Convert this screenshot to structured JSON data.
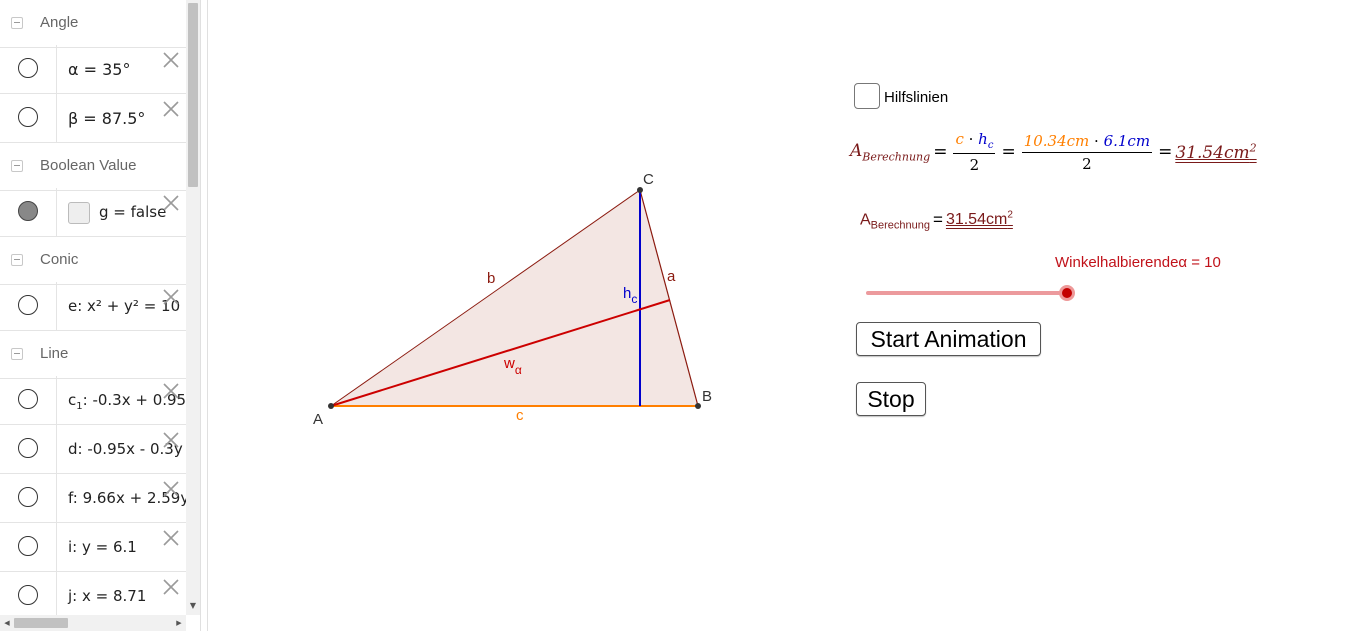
{
  "algebra": {
    "groups": {
      "angle": "Angle",
      "boolean": "Boolean Value",
      "conic": "Conic",
      "line": "Line"
    },
    "items": {
      "alpha": "α = 35°",
      "beta": "β = 87.5°",
      "g": "g = false",
      "e": "e: x² + y² = 10",
      "c1_name": "c",
      "c1_sub": "1",
      "c1_rest": ": -0.3x + 0.95",
      "d": "d: -0.95x - 0.3y",
      "f": "f: 9.66x + 2.59y",
      "i": "i: y = 6.1",
      "j": "j: x = 8.71"
    }
  },
  "graphics": {
    "points": {
      "A": "A",
      "B": "B",
      "C": "C"
    },
    "segments": {
      "a": "a",
      "b": "b",
      "c": "c"
    },
    "altitude": {
      "name": "h",
      "sub": "c"
    },
    "bisector": {
      "name": "w",
      "sub": "α"
    },
    "colors": {
      "triangle_fill": "#f3e6e3",
      "triangle_stroke": "#8b1a0f",
      "side_c": "#ff7f00",
      "altitude": "#0000cc",
      "bisector": "#cc0000"
    }
  },
  "controls": {
    "checkbox_label": "Hilfslinien",
    "formula1": {
      "lhs_main": "A",
      "lhs_sub": "Berechnung",
      "frac1_num_c": "c",
      "frac1_num_dot": " · ",
      "frac1_num_h": "h",
      "frac1_num_hsub": "c",
      "frac1_den": "2",
      "frac2_num_left": "10.34cm",
      "frac2_num_dot": " · ",
      "frac2_num_right": "6.1cm",
      "frac2_den": "2",
      "result": "31.54cm",
      "result_exp": "2"
    },
    "formula2": {
      "lhs_main": "A",
      "lhs_sub": "Berechnung",
      "result": "31.54cm",
      "result_exp": "2"
    },
    "slider": {
      "caption": "Winkelhalbierendeα = 10",
      "value": 10
    },
    "start_button": "Start Animation",
    "stop_button": "Stop"
  }
}
